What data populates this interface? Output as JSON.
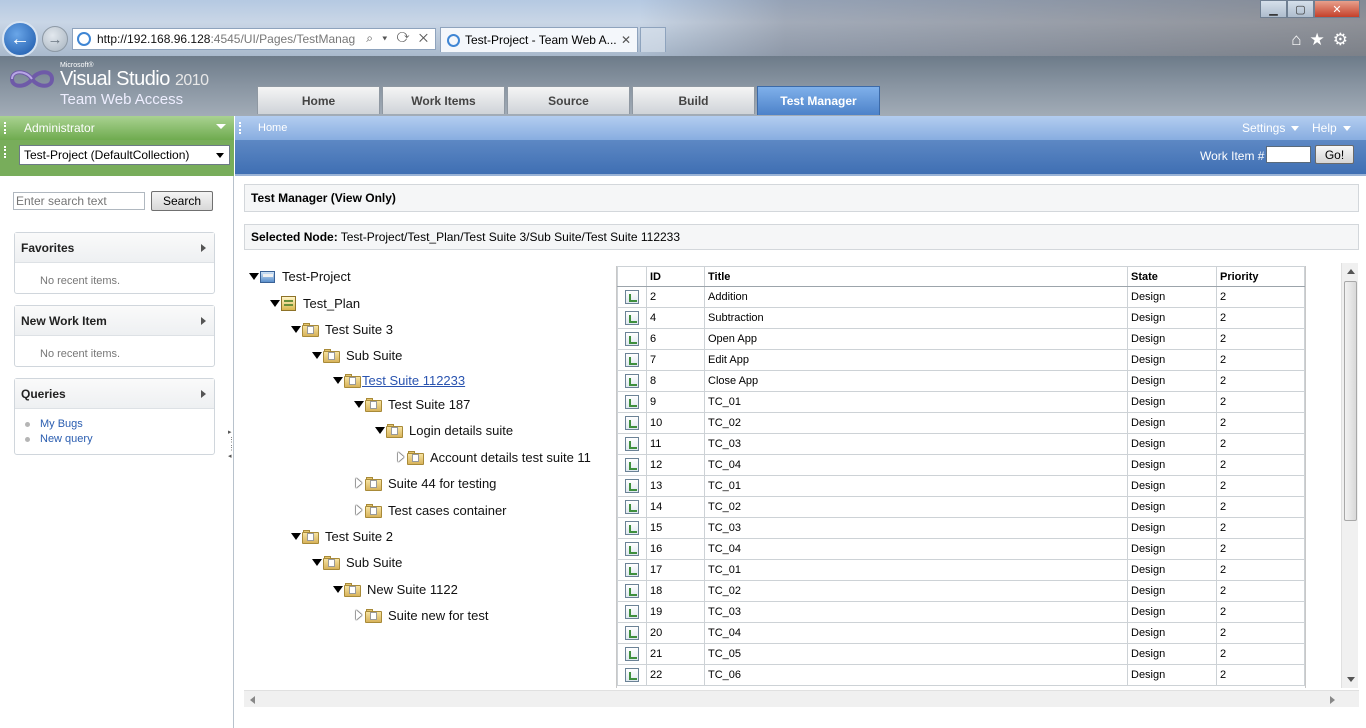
{
  "browser": {
    "address_host": "http://192.168.96.128",
    "address_rest": ":4545/UI/Pages/TestManag",
    "tab_title": "Test-Project - Team Web A...",
    "tab_close": "✕",
    "icons": [
      "home-icon",
      "star-icon",
      "gear-icon"
    ]
  },
  "logo": {
    "microsoft": "Microsoft®",
    "product": "Visual Studio",
    "year": "2010",
    "sub": "Team Web Access"
  },
  "top_tabs": [
    {
      "label": "Home"
    },
    {
      "label": "Work Items"
    },
    {
      "label": "Source"
    },
    {
      "label": "Build"
    },
    {
      "label": "Test Manager",
      "active": true
    }
  ],
  "left": {
    "user": "Administrator",
    "project": "Test-Project (DefaultCollection)",
    "search_placeholder": "Enter search text",
    "search_button": "Search",
    "favorites": {
      "title": "Favorites",
      "empty": "No recent items."
    },
    "new_work_item": {
      "title": "New Work Item",
      "empty": "No recent items."
    },
    "queries": {
      "title": "Queries",
      "items": [
        "My Bugs",
        "New query"
      ]
    }
  },
  "breadcrumb": "Home",
  "settings_label": "Settings",
  "help_label": "Help",
  "work_item_label": "Work Item #",
  "go_button": "Go!",
  "page_title": "Test Manager (View Only)",
  "selected_node": {
    "label": "Selected Node:",
    "path": "Test-Project/Test_Plan/Test Suite 3/Sub Suite/Test Suite 112233"
  },
  "tree": [
    "Test-Project",
    "Test_Plan",
    "Test Suite 3",
    "Sub Suite",
    "Test Suite 112233",
    "Test Suite 187",
    "Login details suite",
    "Account details test suite 11",
    "Suite 44 for testing",
    "Test cases container",
    "Test Suite 2",
    "Sub Suite",
    "New Suite 1122",
    "Suite new for test"
  ],
  "grid": {
    "columns": [
      "ID",
      "Title",
      "State",
      "Priority"
    ],
    "rows": [
      [
        "2",
        "Addition",
        "Design",
        "2"
      ],
      [
        "4",
        "Subtraction",
        "Design",
        "2"
      ],
      [
        "6",
        "Open App",
        "Design",
        "2"
      ],
      [
        "7",
        "Edit App",
        "Design",
        "2"
      ],
      [
        "8",
        "Close App",
        "Design",
        "2"
      ],
      [
        "9",
        "TC_01",
        "Design",
        "2"
      ],
      [
        "10",
        "TC_02",
        "Design",
        "2"
      ],
      [
        "11",
        "TC_03",
        "Design",
        "2"
      ],
      [
        "12",
        "TC_04",
        "Design",
        "2"
      ],
      [
        "13",
        "TC_01",
        "Design",
        "2"
      ],
      [
        "14",
        "TC_02",
        "Design",
        "2"
      ],
      [
        "15",
        "TC_03",
        "Design",
        "2"
      ],
      [
        "16",
        "TC_04",
        "Design",
        "2"
      ],
      [
        "17",
        "TC_01",
        "Design",
        "2"
      ],
      [
        "18",
        "TC_02",
        "Design",
        "2"
      ],
      [
        "19",
        "TC_03",
        "Design",
        "2"
      ],
      [
        "20",
        "TC_04",
        "Design",
        "2"
      ],
      [
        "21",
        "TC_05",
        "Design",
        "2"
      ],
      [
        "22",
        "TC_06",
        "Design",
        "2"
      ]
    ]
  }
}
